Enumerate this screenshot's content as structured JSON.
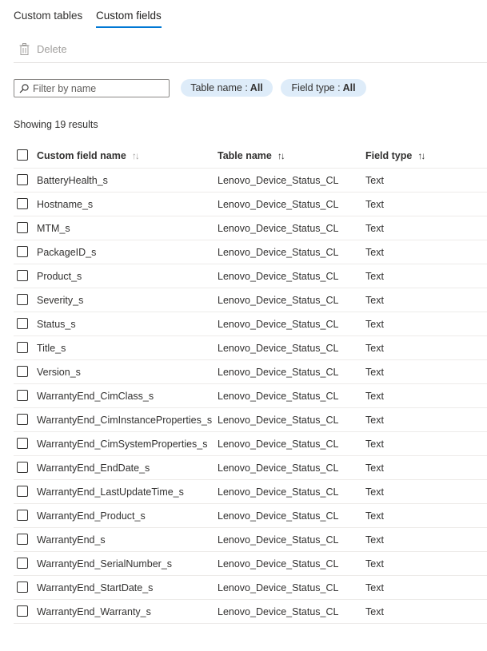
{
  "tabs": [
    {
      "label": "Custom tables",
      "active": false
    },
    {
      "label": "Custom fields",
      "active": true
    }
  ],
  "toolbar": {
    "delete_label": "Delete",
    "delete_icon": "trash-icon"
  },
  "search": {
    "placeholder": "Filter by name",
    "value": "",
    "icon": "search-icon"
  },
  "filters": {
    "table_name": {
      "label": "Table name :",
      "value": "All"
    },
    "field_type": {
      "label": "Field type :",
      "value": "All"
    }
  },
  "results_text": "Showing 19 results",
  "table": {
    "columns": [
      "Custom field name",
      "Table name",
      "Field type"
    ],
    "sort_icon": "↑↓",
    "rows": [
      {
        "name": "BatteryHealth_s",
        "table": "Lenovo_Device_Status_CL",
        "type": "Text"
      },
      {
        "name": "Hostname_s",
        "table": "Lenovo_Device_Status_CL",
        "type": "Text"
      },
      {
        "name": "MTM_s",
        "table": "Lenovo_Device_Status_CL",
        "type": "Text"
      },
      {
        "name": "PackageID_s",
        "table": "Lenovo_Device_Status_CL",
        "type": "Text"
      },
      {
        "name": "Product_s",
        "table": "Lenovo_Device_Status_CL",
        "type": "Text"
      },
      {
        "name": "Severity_s",
        "table": "Lenovo_Device_Status_CL",
        "type": "Text"
      },
      {
        "name": "Status_s",
        "table": "Lenovo_Device_Status_CL",
        "type": "Text"
      },
      {
        "name": "Title_s",
        "table": "Lenovo_Device_Status_CL",
        "type": "Text"
      },
      {
        "name": "Version_s",
        "table": "Lenovo_Device_Status_CL",
        "type": "Text"
      },
      {
        "name": "WarrantyEnd_CimClass_s",
        "table": "Lenovo_Device_Status_CL",
        "type": "Text"
      },
      {
        "name": "WarrantyEnd_CimInstanceProperties_s",
        "table": "Lenovo_Device_Status_CL",
        "type": "Text"
      },
      {
        "name": "WarrantyEnd_CimSystemProperties_s",
        "table": "Lenovo_Device_Status_CL",
        "type": "Text"
      },
      {
        "name": "WarrantyEnd_EndDate_s",
        "table": "Lenovo_Device_Status_CL",
        "type": "Text"
      },
      {
        "name": "WarrantyEnd_LastUpdateTime_s",
        "table": "Lenovo_Device_Status_CL",
        "type": "Text"
      },
      {
        "name": "WarrantyEnd_Product_s",
        "table": "Lenovo_Device_Status_CL",
        "type": "Text"
      },
      {
        "name": "WarrantyEnd_s",
        "table": "Lenovo_Device_Status_CL",
        "type": "Text"
      },
      {
        "name": "WarrantyEnd_SerialNumber_s",
        "table": "Lenovo_Device_Status_CL",
        "type": "Text"
      },
      {
        "name": "WarrantyEnd_StartDate_s",
        "table": "Lenovo_Device_Status_CL",
        "type": "Text"
      },
      {
        "name": "WarrantyEnd_Warranty_s",
        "table": "Lenovo_Device_Status_CL",
        "type": "Text"
      }
    ]
  },
  "colors": {
    "accent": "#0078d4",
    "pill_bg": "#deecf9",
    "divider": "#edebe9",
    "disabled_text": "#a19f9d"
  }
}
